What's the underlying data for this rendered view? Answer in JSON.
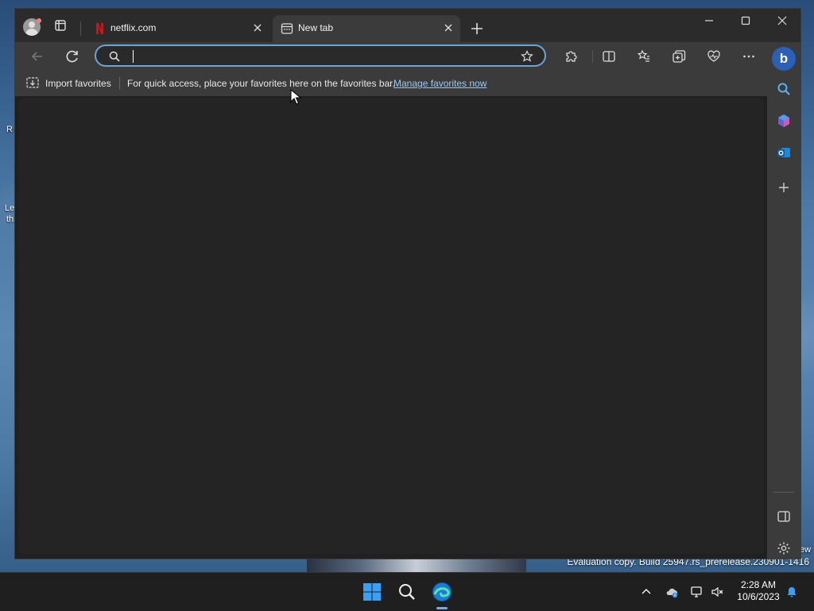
{
  "desktop": {
    "edge_text_1": "R",
    "edge_text_2": "Le",
    "edge_text_3": "th",
    "edge_text_4": "ew",
    "watermark": "Evaluation copy. Build 25947.rs_prerelease.230901-1416"
  },
  "browser": {
    "tabs": [
      {
        "title": "netflix.com",
        "icon": "netflix-icon",
        "active": false
      },
      {
        "title": "New tab",
        "icon": "new-tab-page-icon",
        "active": true
      }
    ],
    "address_bar": {
      "value": "",
      "placeholder": ""
    },
    "favorites_bar": {
      "import_label": "Import favorites",
      "hint": "For quick access, place your favorites here on the favorites bar.",
      "manage_link": "Manage favorites now"
    },
    "accent_color": "#6aa5d6"
  },
  "taskbar": {
    "time": "2:28 AM",
    "date": "10/6/2023"
  }
}
